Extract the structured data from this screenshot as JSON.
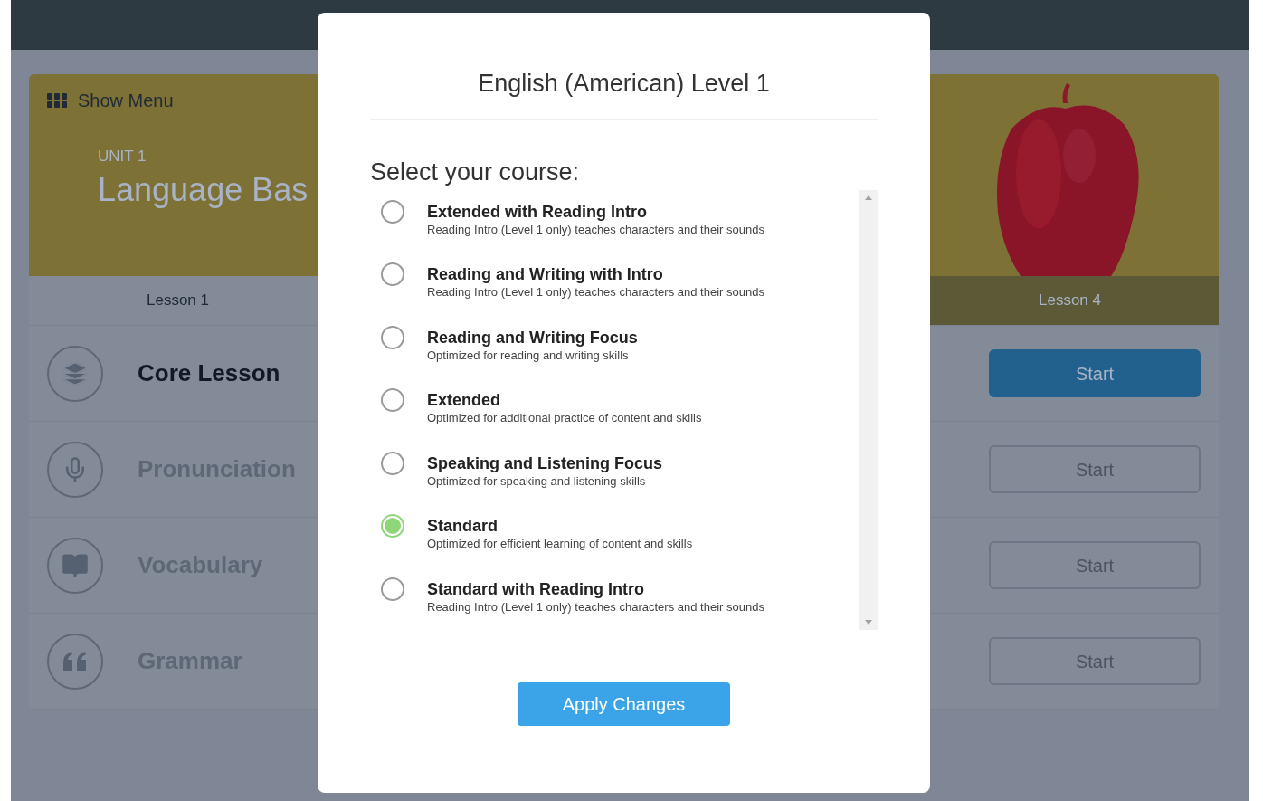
{
  "menu_button": {
    "label": "Show Menu"
  },
  "unit": {
    "label": "UNIT 1",
    "title": "Language Bas"
  },
  "lessons": [
    {
      "label": "Lesson 1",
      "selected": false
    },
    {
      "label": "Lesson 4",
      "selected": true
    }
  ],
  "activities": [
    {
      "kind": "layers",
      "title": "Core Lesson",
      "active": true,
      "button": "Start"
    },
    {
      "kind": "microphone",
      "title": "Pronunciation",
      "active": false,
      "button": "Start"
    },
    {
      "kind": "book",
      "title": "Vocabulary",
      "active": false,
      "button": "Start"
    },
    {
      "kind": "quote",
      "title": "Grammar",
      "active": false,
      "button": "Start"
    }
  ],
  "dialog": {
    "title": "English (American) Level 1",
    "prompt": "Select your course:",
    "options": [
      {
        "title": "Extended with Reading Intro",
        "description": "Reading Intro (Level 1 only) teaches characters and their sounds",
        "selected": false
      },
      {
        "title": "Reading and Writing with Intro",
        "description": "Reading Intro (Level 1 only) teaches characters and their sounds",
        "selected": false
      },
      {
        "title": "Reading and Writing Focus",
        "description": "Optimized for reading and writing skills",
        "selected": false
      },
      {
        "title": "Extended",
        "description": "Optimized for additional practice of content and skills",
        "selected": false
      },
      {
        "title": "Speaking and Listening Focus",
        "description": "Optimized for speaking and listening skills",
        "selected": false
      },
      {
        "title": "Standard",
        "description": "Optimized for efficient learning of content and skills",
        "selected": true
      },
      {
        "title": "Standard with Reading Intro",
        "description": "Reading Intro (Level 1 only) teaches characters and their sounds",
        "selected": false
      }
    ],
    "apply_button": "Apply Changes"
  }
}
